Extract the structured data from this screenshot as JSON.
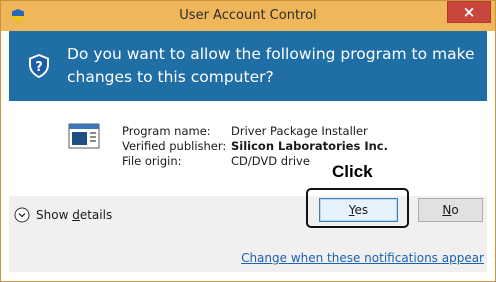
{
  "window": {
    "title": "User Account Control",
    "close_glyph": "×"
  },
  "banner": {
    "question": "Do you want to allow the following program to make changes to this computer?",
    "icon": "question-shield-icon"
  },
  "details": {
    "program_name_label": "Program name:",
    "program_name_value": "Driver Package Installer",
    "publisher_label": "Verified publisher:",
    "publisher_value": "Silicon Laboratories Inc.",
    "origin_label": "File origin:",
    "origin_value": "CD/DVD drive"
  },
  "annotation": {
    "click_label": "Click"
  },
  "footer": {
    "show_details_prefix": "Show ",
    "show_details_underlined": "d",
    "show_details_suffix": "etails",
    "yes_underlined": "Y",
    "yes_suffix": "es",
    "no_underlined": "N",
    "no_suffix": "o",
    "notifications_link": "Change when these notifications appear"
  },
  "colors": {
    "titlebar": "#f0b75a",
    "banner": "#1f6fa6",
    "close_button": "#c9463d",
    "link": "#1a63b0",
    "footer": "#f0f0f0"
  }
}
